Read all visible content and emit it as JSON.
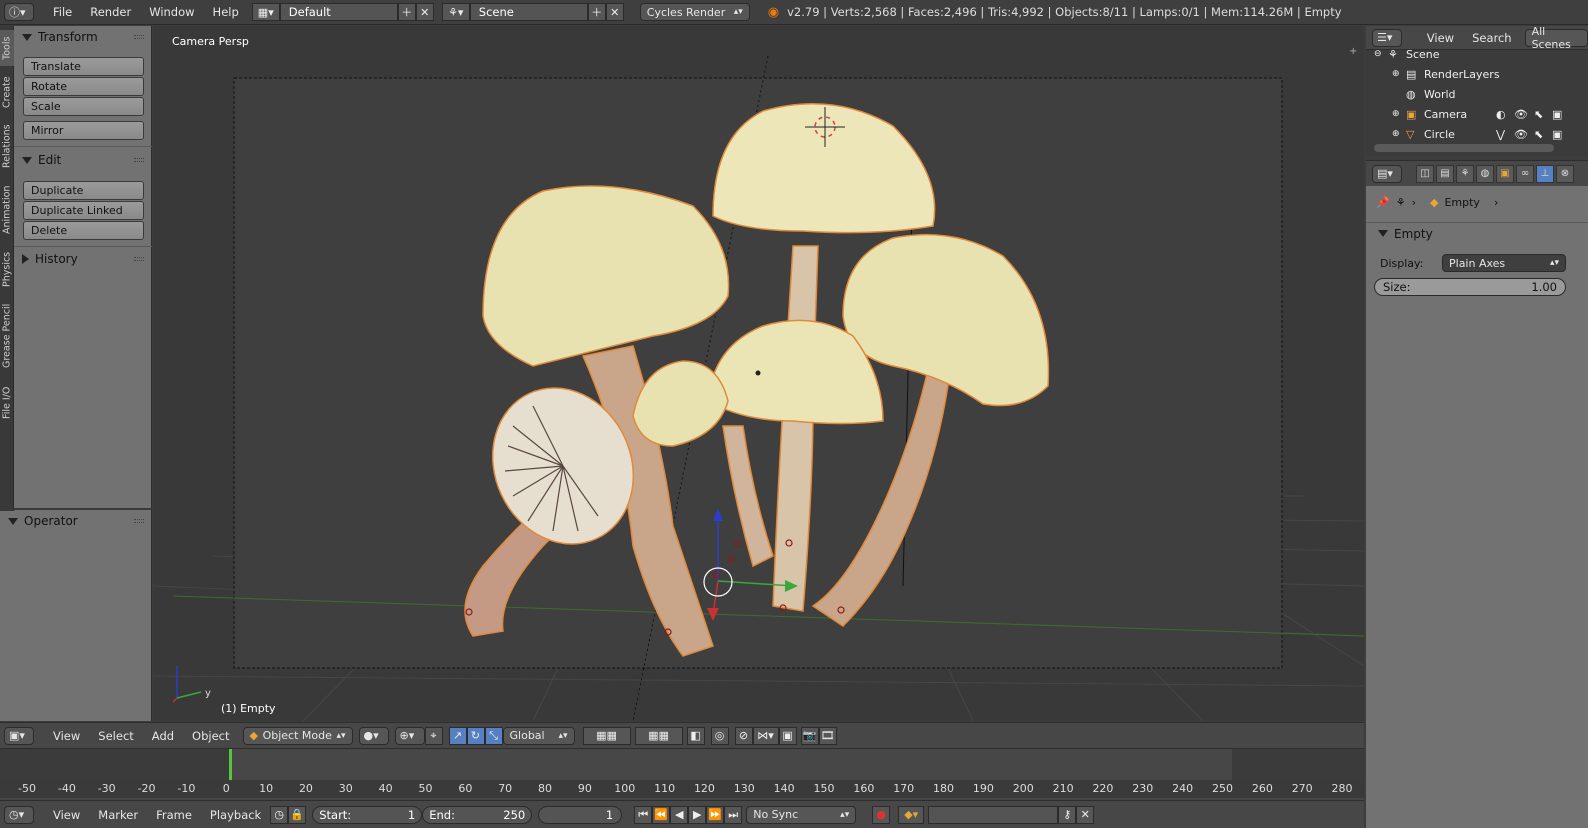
{
  "topbar": {
    "menus": [
      "File",
      "Render",
      "Window",
      "Help"
    ],
    "screen_layout": "Default",
    "scene": "Scene",
    "engine": "Cycles Render",
    "stats": "v2.79 | Verts:2,568 | Faces:2,496 | Tris:4,992 | Objects:8/11 | Lamps:0/1 | Mem:114.26M | Empty"
  },
  "left_tabs": [
    "Tools",
    "Create",
    "Relations",
    "Animation",
    "Physics",
    "Grease Pencil",
    "File I/O"
  ],
  "toolshelf": {
    "transform": {
      "title": "Transform",
      "buttons": [
        "Translate",
        "Rotate",
        "Scale",
        "Mirror"
      ]
    },
    "edit": {
      "title": "Edit",
      "buttons": [
        "Duplicate",
        "Duplicate Linked",
        "Delete"
      ]
    },
    "history": {
      "title": "History"
    },
    "operator": {
      "title": "Operator"
    }
  },
  "viewport": {
    "view_name": "Camera Persp",
    "object_info": "(1) Empty",
    "axis_y": "y"
  },
  "header3d": {
    "menus": [
      "View",
      "Select",
      "Add",
      "Object"
    ],
    "mode": "Object Mode",
    "orientation": "Global"
  },
  "timeline": {
    "ticks": [
      "-50",
      "-40",
      "-30",
      "-20",
      "-10",
      "0",
      "10",
      "20",
      "30",
      "40",
      "50",
      "60",
      "70",
      "80",
      "90",
      "100",
      "110",
      "120",
      "130",
      "140",
      "150",
      "160",
      "170",
      "180",
      "190",
      "200",
      "210",
      "220",
      "230",
      "240",
      "250",
      "260",
      "270",
      "280"
    ],
    "menus": [
      "View",
      "Marker",
      "Frame",
      "Playback"
    ],
    "start_label": "Start:",
    "start_value": "1",
    "end_label": "End:",
    "end_value": "250",
    "current_frame": "1",
    "sync": "No Sync"
  },
  "outliner": {
    "menus": [
      "View",
      "Search"
    ],
    "filter": "All Scenes",
    "items": [
      "Scene",
      "RenderLayers",
      "World",
      "Camera",
      "Circle"
    ]
  },
  "properties": {
    "context_name": "Empty",
    "panel_title": "Empty",
    "display_label": "Display:",
    "display_value": "Plain Axes",
    "size_label": "Size:",
    "size_value": "1.00"
  },
  "colors": {
    "accent_blue": "#5680c2",
    "frame_marker": "#58c43a",
    "mushroom_cap": "#e8e2b0",
    "selection_outline": "#e08a3a"
  }
}
